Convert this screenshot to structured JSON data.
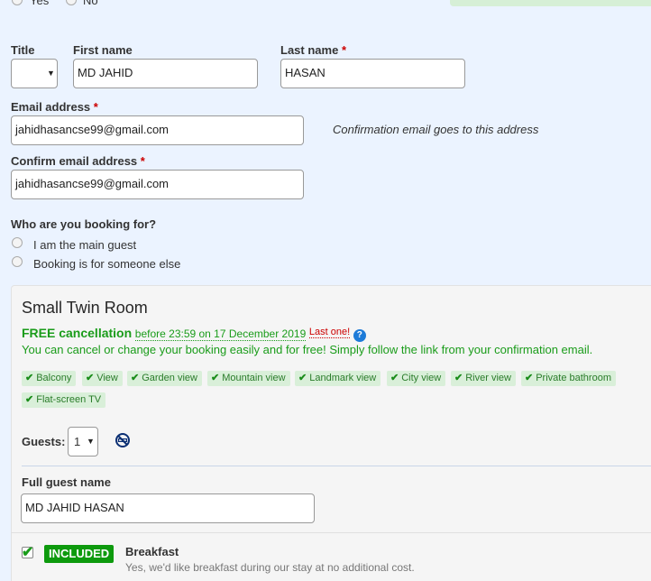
{
  "top_options": {
    "yes": "Yes",
    "no": "No"
  },
  "form": {
    "title_label": "Title",
    "title_value": "",
    "first_name_label": "First name",
    "first_name_value": "MD JAHID",
    "last_name_label": "Last name",
    "last_name_value": "HASAN",
    "email_label": "Email address",
    "email_value": "jahidhasancse99@gmail.com",
    "email_hint": "Confirmation email goes to this address",
    "confirm_email_label": "Confirm email address",
    "confirm_email_value": "jahidhasancse99@gmail.com",
    "required_mark": "*",
    "booking_for_label": "Who are you booking for?",
    "booking_for_options": [
      "I am the main guest",
      "Booking is for someone else"
    ]
  },
  "room": {
    "title": "Small Twin Room",
    "free_cancellation": "FREE cancellation",
    "cancel_deadline": "before 23:59 on 17 December 2019",
    "last_one": "Last one!",
    "help": "?",
    "cancel_note": "You can cancel or change your booking easily and for free! Simply follow the link from your confirmation email.",
    "facilities": [
      "Balcony",
      "View",
      "Garden view",
      "Mountain view",
      "Landmark view",
      "City view",
      "River view",
      "Private bathroom",
      "Flat-screen TV"
    ],
    "guests_label": "Guests:",
    "guests_value": "1",
    "full_guest_name_label": "Full guest name",
    "full_guest_name_value": "MD JAHID HASAN",
    "included_badge": "INCLUDED",
    "breakfast_title": "Breakfast",
    "breakfast_note": "Yes, we'd like breakfast during our stay at no additional cost."
  },
  "colors": {
    "page_bg": "#ebf3ff",
    "free_green": "#1a9c1a",
    "required_red": "#cc0000",
    "help_blue": "#1d7bd8",
    "included_green": "#0d9a0d"
  },
  "icons": {
    "tag_check": "checkmark-icon",
    "no_smoking": "no-smoking-icon",
    "help": "question-icon"
  }
}
